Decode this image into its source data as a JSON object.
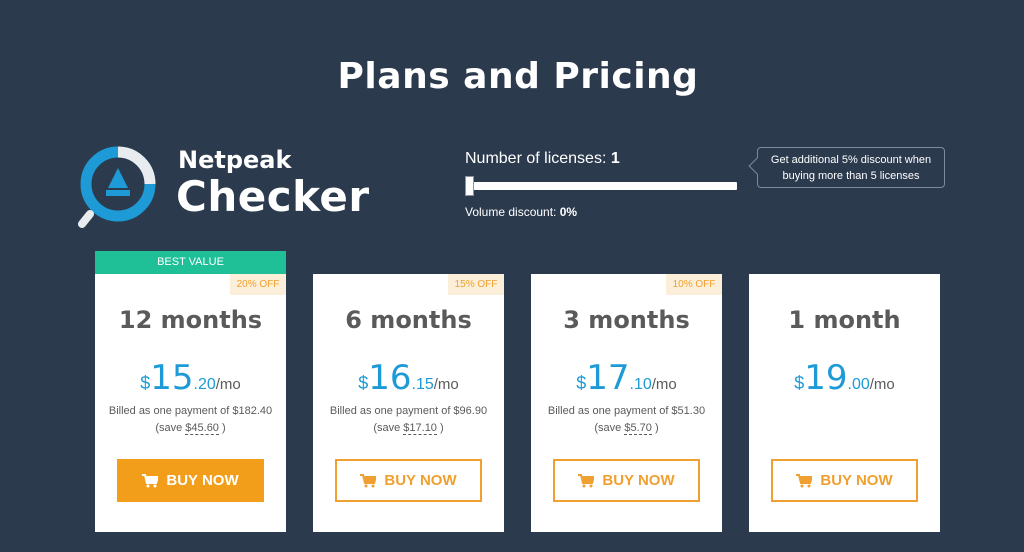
{
  "header": {
    "title": "Plans and Pricing"
  },
  "logo": {
    "line1": "Netpeak",
    "line2": "Checker"
  },
  "licenses": {
    "label": "Number of licenses:",
    "count": "1",
    "volume_label": "Volume discount:",
    "volume_value": "0%",
    "tooltip": "Get additional 5% discount when buying more than 5 licenses"
  },
  "plans": [
    {
      "badge": "BEST VALUE",
      "discount": "20% OFF",
      "duration": "12 months",
      "currency": "$",
      "price_whole": "15",
      "price_cents": ".20",
      "per": "/mo",
      "billed": "Billed as one payment of $182.40",
      "save_prefix": "(save",
      "save_amount": "$45.60",
      "save_suffix": ")",
      "button": "BUY NOW"
    },
    {
      "discount": "15% OFF",
      "duration": "6 months",
      "currency": "$",
      "price_whole": "16",
      "price_cents": ".15",
      "per": "/mo",
      "billed": "Billed as one payment of $96.90",
      "save_prefix": "(save",
      "save_amount": "$17.10",
      "save_suffix": ")",
      "button": "BUY NOW"
    },
    {
      "discount": "10% OFF",
      "duration": "3 months",
      "currency": "$",
      "price_whole": "17",
      "price_cents": ".10",
      "per": "/mo",
      "billed": "Billed as one payment of $51.30",
      "save_prefix": "(save",
      "save_amount": "$5.70",
      "save_suffix": ")",
      "button": "BUY NOW"
    },
    {
      "duration": "1 month",
      "currency": "$",
      "price_whole": "19",
      "price_cents": ".00",
      "per": "/mo",
      "button": "BUY NOW"
    }
  ],
  "colors": {
    "background": "#2c3a4e",
    "accent_blue": "#1e9ad6",
    "accent_orange": "#f29e1a",
    "best_value_green": "#1fbf98"
  },
  "icons": [
    "netpeak-checker-logo-icon",
    "cart-icon"
  ]
}
